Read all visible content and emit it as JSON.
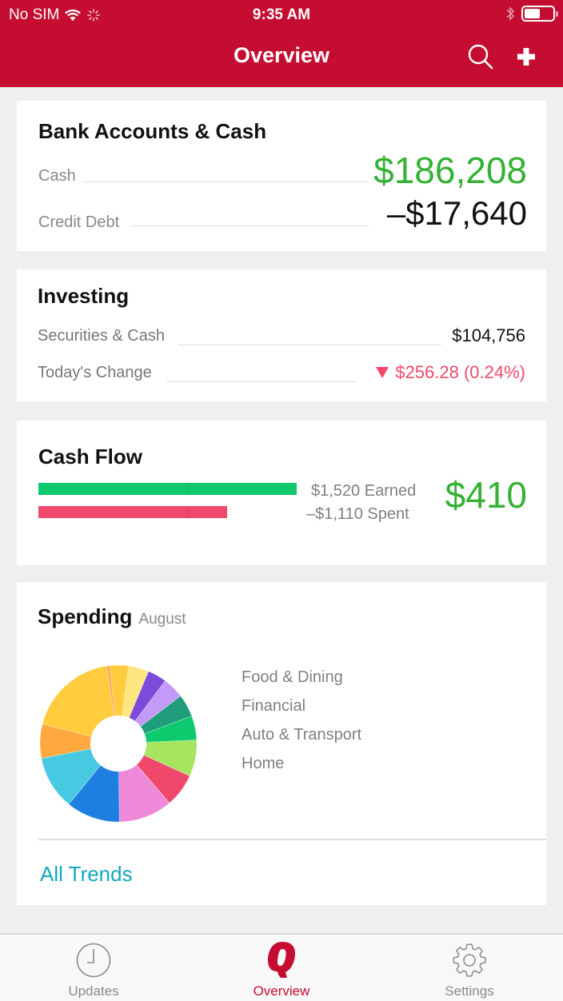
{
  "status_bar": {
    "carrier": "No SIM",
    "time": "9:35 AM",
    "battery_level": 0.55,
    "icons": [
      "wifi-icon",
      "activity-spinner-icon",
      "bluetooth-icon",
      "battery-icon"
    ]
  },
  "nav": {
    "title": "Overview",
    "search_icon": "search-icon",
    "add_icon": "plus-icon"
  },
  "bank": {
    "title": "Bank Accounts & Cash",
    "rows": [
      {
        "label": "Cash",
        "value": "$186,208",
        "color": "#34B233"
      },
      {
        "label": "Credit Debt",
        "value": "–$17,640",
        "color": "#111111"
      }
    ]
  },
  "investing": {
    "title": "Investing",
    "rows": [
      {
        "label": "Securities & Cash",
        "value": "$104,756"
      },
      {
        "label": "Today's Change",
        "value": "$256.28 (0.24%)",
        "direction_icon": "triangle-down-icon",
        "color": "#F0486A"
      }
    ]
  },
  "cash_flow": {
    "title": "Cash Flow",
    "earned": {
      "label": "$1,520 Earned",
      "amount": 1520,
      "color": "#0ECA6E"
    },
    "spent": {
      "label": "–$1,110 Spent",
      "amount": 1110,
      "color": "#F0486A"
    },
    "net": "$410",
    "net_color": "#34B233"
  },
  "spending": {
    "title": "Spending",
    "period": "August",
    "legend": [
      "Food & Dining",
      "Financial",
      "Auto & Transport",
      "Home"
    ],
    "all_trends_label": "All Trends",
    "link_color": "#12A9BE"
  },
  "chart_data": {
    "type": "pie",
    "title": "Spending August",
    "donut": true,
    "legend": [
      "Food & Dining",
      "Financial",
      "Auto & Transport",
      "Home"
    ],
    "slices": [
      {
        "color": "#FFCC3D",
        "value": 18.6
      },
      {
        "color": "#FFA35C",
        "value": 0.6
      },
      {
        "color": "#FFCC3D",
        "value": 3.9
      },
      {
        "color": "#FFE680",
        "value": 4.2
      },
      {
        "color": "#7B4BDA",
        "value": 3.9
      },
      {
        "color": "#C19BF7",
        "value": 4.4
      },
      {
        "color": "#1E9E7A",
        "value": 4.7
      },
      {
        "color": "#0ECA6E",
        "value": 5.0
      },
      {
        "color": "#A8E55E",
        "value": 7.5
      },
      {
        "color": "#F0486A",
        "value": 6.9
      },
      {
        "color": "#EE88D8",
        "value": 11.1
      },
      {
        "color": "#1E7FE3",
        "value": 11.1
      },
      {
        "color": "#48C9E2",
        "value": 11.1
      },
      {
        "color": "#FFA83D",
        "value": 7.0
      }
    ]
  },
  "tabs": [
    {
      "label": "Updates",
      "icon": "clock-icon",
      "active": false
    },
    {
      "label": "Overview",
      "icon": "quicken-q-icon",
      "active": true
    },
    {
      "label": "Settings",
      "icon": "gear-icon",
      "active": false
    }
  ],
  "colors": {
    "brand": "#C40D30",
    "background": "#EFEFEF"
  }
}
